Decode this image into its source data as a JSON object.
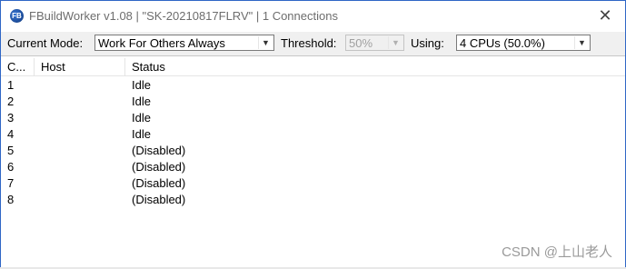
{
  "window": {
    "title": "FBuildWorker v1.08 | \"SK-20210817FLRV\" | 1 Connections",
    "close_glyph": "✕"
  },
  "toolbar": {
    "mode_label": "Current Mode:",
    "mode_value": "Work For Others Always",
    "threshold_label": "Threshold:",
    "threshold_value": "50%",
    "using_label": "Using:",
    "using_value": "4 CPUs (50.0%)"
  },
  "list": {
    "columns": [
      "C...",
      "Host",
      "Status"
    ],
    "rows": [
      {
        "cpu": "1",
        "host": "",
        "status": "Idle"
      },
      {
        "cpu": "2",
        "host": "",
        "status": "Idle"
      },
      {
        "cpu": "3",
        "host": "",
        "status": "Idle"
      },
      {
        "cpu": "4",
        "host": "",
        "status": "Idle"
      },
      {
        "cpu": "5",
        "host": "",
        "status": "(Disabled)"
      },
      {
        "cpu": "6",
        "host": "",
        "status": "(Disabled)"
      },
      {
        "cpu": "7",
        "host": "",
        "status": "(Disabled)"
      },
      {
        "cpu": "8",
        "host": "",
        "status": "(Disabled)"
      }
    ]
  },
  "watermark": "CSDN @上山老人",
  "icons": {
    "app": "fastbuild-app-icon",
    "close": "close-icon",
    "dropdown": "chevron-down-icon"
  }
}
